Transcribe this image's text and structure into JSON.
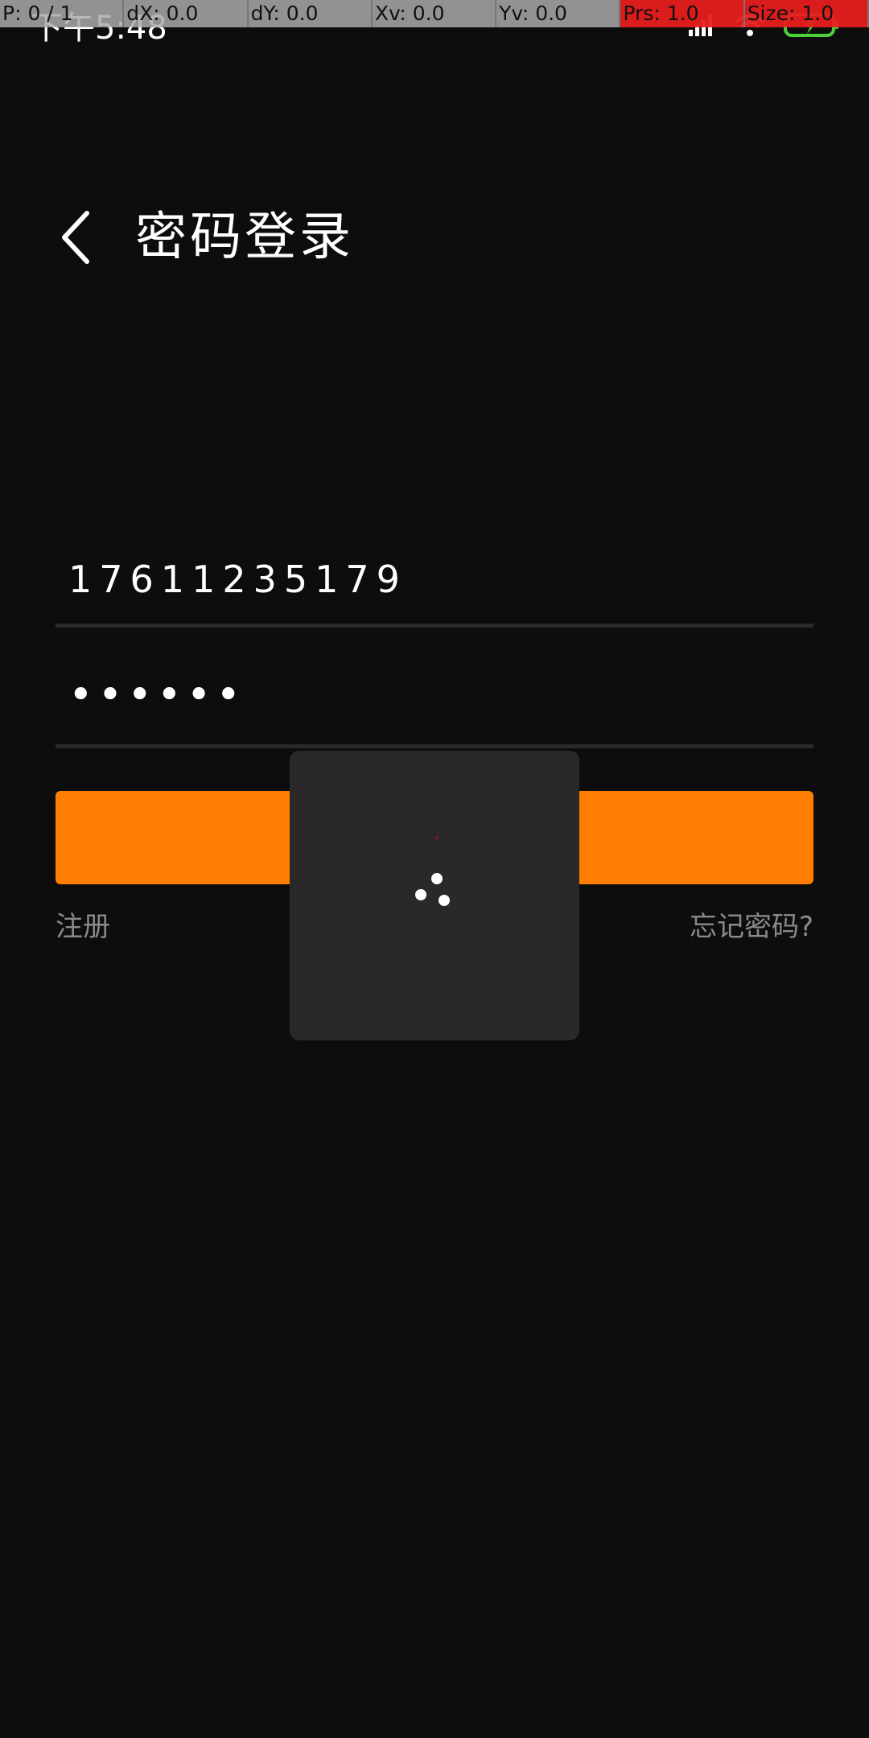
{
  "status_bar": {
    "time": "下午5:48",
    "icons": [
      "signal-icon",
      "wifi-icon",
      "battery-charging-icon"
    ]
  },
  "debug_overlay": {
    "cells": [
      "P: 0 / 1",
      "dX: 0.0",
      "dY: 0.0",
      "Xv: 0.0",
      "Yv: 0.0",
      "Prs: 1.0",
      "Size: 1.0"
    ]
  },
  "header": {
    "title": "密码登录",
    "back_icon": "chevron-left-icon"
  },
  "form": {
    "phone_value": "17611235179",
    "password_value": "••••••",
    "login_button_label": ""
  },
  "links": {
    "register": "注册",
    "forgot": "忘记密码?"
  },
  "colors": {
    "background": "#0d0d0d",
    "accent": "#ff7d00",
    "dialog": "#2a2829",
    "link": "#8a8a8a"
  },
  "loading": {
    "icon": "loading-spinner-icon"
  }
}
